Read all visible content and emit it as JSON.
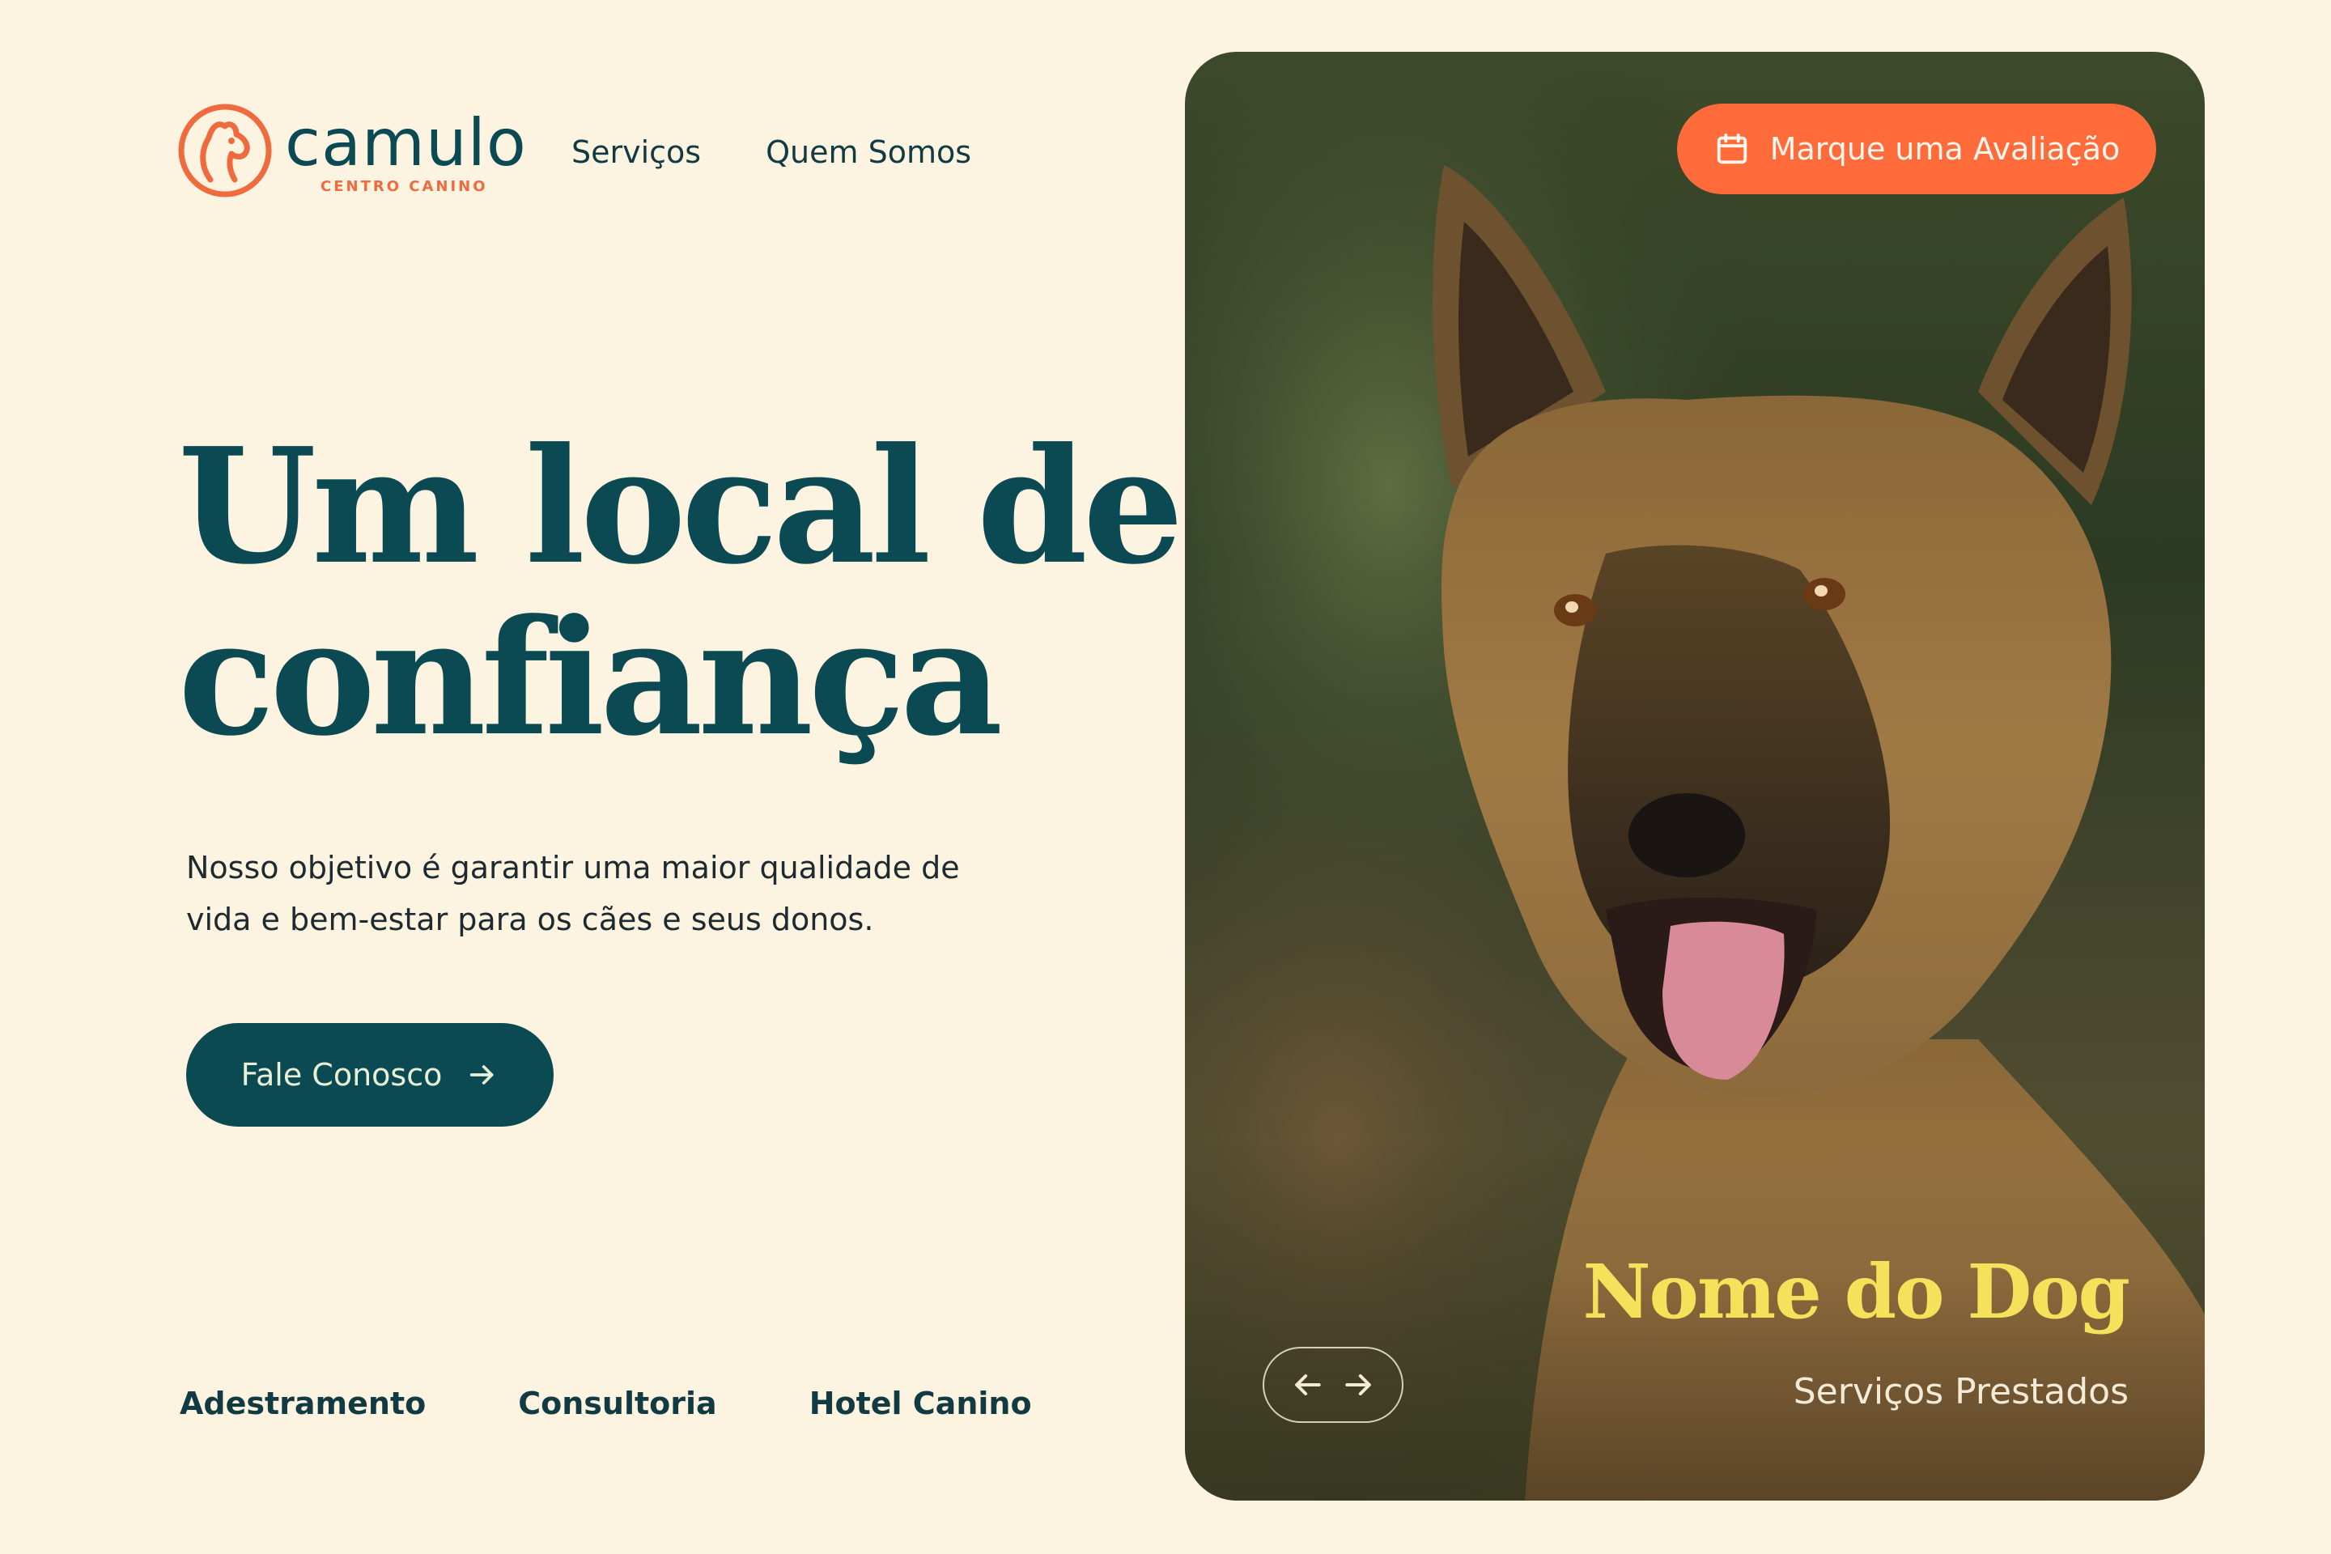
{
  "brand": {
    "name": "camulo",
    "tagline": "CENTRO CANINO",
    "accent": "#ef6b3d",
    "primary": "#0c4a53",
    "background": "#fdf3e1"
  },
  "nav": {
    "items": [
      "Serviços",
      "Quem Somos"
    ]
  },
  "hero": {
    "title_line1": "Um local de",
    "title_line2": "confiança",
    "text": "Nosso objetivo é garantir uma maior qualidade de vida e bem-estar para os cães e seus donos.",
    "cta_label": "Fale Conosco",
    "cta_icon": "arrow-right-icon"
  },
  "services": [
    "Adestramento",
    "Consultoria",
    "Hotel Canino"
  ],
  "card": {
    "book_label": "Marque uma Avaliação",
    "book_icon": "calendar-icon",
    "dog_name": "Nome do Dog",
    "dog_sub": "Serviços Prestados",
    "prev_icon": "arrow-left-icon",
    "next_icon": "arrow-right-icon",
    "name_color": "#f6e25a",
    "button_color": "#ff6b3a"
  }
}
